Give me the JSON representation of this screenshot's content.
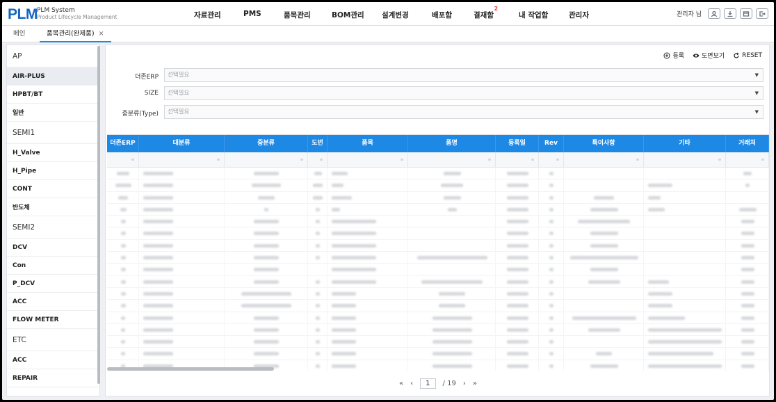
{
  "app": {
    "logo": "PLM",
    "title": "PLM System",
    "subtitle": "Product Lifecycle Management"
  },
  "nav": {
    "items": [
      {
        "label": "자료관리"
      },
      {
        "label": "PMS"
      },
      {
        "label": "품목관리"
      },
      {
        "label": "BOM관리"
      },
      {
        "label": "설계변경"
      },
      {
        "label": "배포함"
      },
      {
        "label": "결재함",
        "badge": "2"
      },
      {
        "label": "내 작업함"
      },
      {
        "label": "관리자"
      }
    ]
  },
  "user": {
    "name": "관리자 님",
    "icons": [
      "user-icon",
      "download-icon",
      "window-icon",
      "logout-icon"
    ]
  },
  "tabs": [
    {
      "label": "메인"
    },
    {
      "label": "품목관리(완제품)",
      "close": "×"
    }
  ],
  "sidebar": {
    "items": [
      {
        "label": "AP",
        "type": "category"
      },
      {
        "label": "AIR-PLUS",
        "type": "item",
        "active": true
      },
      {
        "label": "HPBT/BT",
        "type": "item"
      },
      {
        "label": "일반",
        "type": "item"
      },
      {
        "label": "SEMI1",
        "type": "category"
      },
      {
        "label": "H_Valve",
        "type": "item"
      },
      {
        "label": "H_Pipe",
        "type": "item"
      },
      {
        "label": "CONT",
        "type": "item"
      },
      {
        "label": "반도체",
        "type": "item"
      },
      {
        "label": "SEMI2",
        "type": "category"
      },
      {
        "label": "DCV",
        "type": "item"
      },
      {
        "label": "Con",
        "type": "item"
      },
      {
        "label": "P_DCV",
        "type": "item"
      },
      {
        "label": "ACC",
        "type": "item"
      },
      {
        "label": "FLOW METER",
        "type": "item"
      },
      {
        "label": "ETC",
        "type": "category"
      },
      {
        "label": "ACC",
        "type": "item"
      },
      {
        "label": "REPAIR",
        "type": "item"
      }
    ]
  },
  "actions": {
    "register": "등록",
    "drawing_view": "도면보기",
    "reset": "RESET"
  },
  "filters": [
    {
      "label": "더존ERP",
      "placeholder": "선택필요"
    },
    {
      "label": "SIZE",
      "placeholder": "선택필요"
    },
    {
      "label": "중분류(Type)",
      "placeholder": "선택필요"
    }
  ],
  "grid": {
    "columns": [
      "더존ERP",
      "대분류",
      "중분류",
      "도번",
      "품목",
      "품명",
      "등록일",
      "Rev",
      "특이사항",
      "기타",
      "거래처"
    ]
  },
  "pager": {
    "first": "«",
    "prev": "‹",
    "current": "1",
    "total": "/ 19",
    "next": "›",
    "last": "»"
  },
  "colors": {
    "brand": "#1565c0",
    "grid_header": "#1e88e5",
    "badge": "#e53935"
  }
}
